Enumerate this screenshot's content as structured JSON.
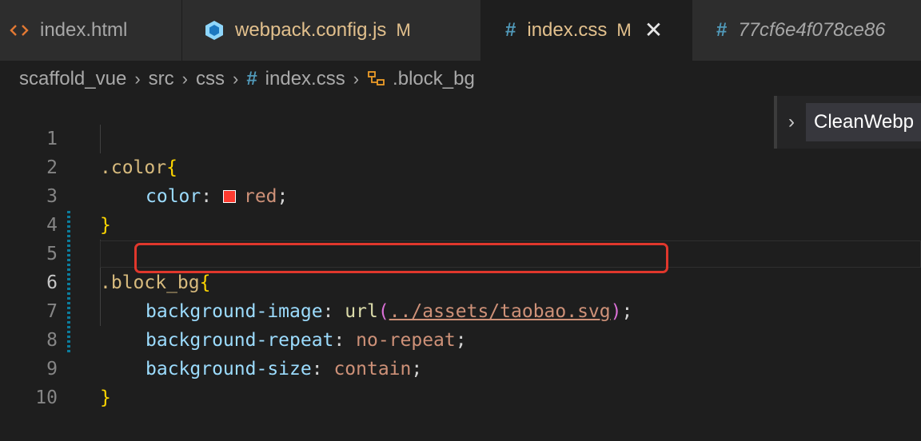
{
  "tabs": [
    {
      "label": "index.html",
      "icon": "html-code-icon",
      "modified": "",
      "active": false
    },
    {
      "label": "webpack.config.js",
      "icon": "webpack-cube-icon",
      "modified": "M",
      "active": false
    },
    {
      "label": "index.css",
      "icon": "css-hash-icon",
      "modified": "M",
      "active": true,
      "close": "✕"
    },
    {
      "label": "77cf6e4f078ce86",
      "icon": "css-hash-icon",
      "modified": "",
      "active": false
    }
  ],
  "breadcrumb": {
    "items": [
      "scaffold_vue",
      "src",
      "css",
      "index.css",
      ".block_bg"
    ],
    "separator": "›",
    "file_icon": "#"
  },
  "outline_panel": {
    "chevron": "›",
    "label": "CleanWebp"
  },
  "editor": {
    "line_numbers": [
      "1",
      "2",
      "3",
      "4",
      "5",
      "6",
      "7",
      "8",
      "9",
      "10"
    ],
    "current_line": "6",
    "lines": [
      {
        "selector": ".color",
        "open": "{"
      },
      {
        "prop": "color",
        "colon": ":",
        "value": "red",
        "semi": ";"
      },
      {
        "close": "}"
      },
      {},
      {
        "selector": ".block_bg",
        "open": "{"
      },
      {
        "prop": "background-image",
        "colon": ":",
        "fn": "url",
        "paren_open": "(",
        "url": "../assets/taobao.svg",
        "paren_close": ")",
        "semi": ";"
      },
      {
        "prop": "background-repeat",
        "colon": ":",
        "value": "no-repeat",
        "semi": ";"
      },
      {
        "prop": "background-size",
        "colon": ":",
        "value": "contain",
        "semi": ";"
      },
      {
        "close": "}"
      },
      {}
    ]
  },
  "colors": {
    "accent_highlight": "#e0372c",
    "swatch_red": "#ff3b30",
    "modified_badge": "#e2c08d",
    "css_icon": "#519aba"
  }
}
